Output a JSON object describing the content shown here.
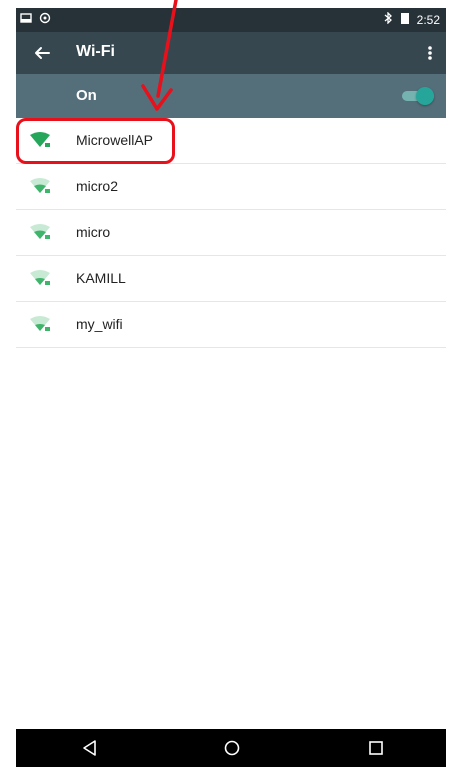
{
  "status_bar": {
    "time": "2:52"
  },
  "toolbar": {
    "title": "Wi-Fi"
  },
  "switch": {
    "label": "On",
    "state": true
  },
  "networks": [
    {
      "ssid": "MicrowellAP",
      "signal_color": "#26a65b"
    },
    {
      "ssid": "micro2",
      "signal_color": "#7fcf9e"
    },
    {
      "ssid": "micro",
      "signal_color": "#7fcf9e"
    },
    {
      "ssid": "KAMILL",
      "signal_color": "#7fcf9e"
    },
    {
      "ssid": "my_wifi",
      "signal_color": "#7fcf9e"
    }
  ],
  "colors": {
    "status_bar": "#263238",
    "toolbar": "#37474f",
    "switch_bar": "#546e7a",
    "accent": "#26a69a",
    "annotation": "#e8101a"
  },
  "icons": [
    "back-icon",
    "more-vert-icon",
    "wifi-icon",
    "bluetooth-icon",
    "battery-icon",
    "nav-back-icon",
    "nav-home-icon",
    "nav-recents-icon"
  ]
}
